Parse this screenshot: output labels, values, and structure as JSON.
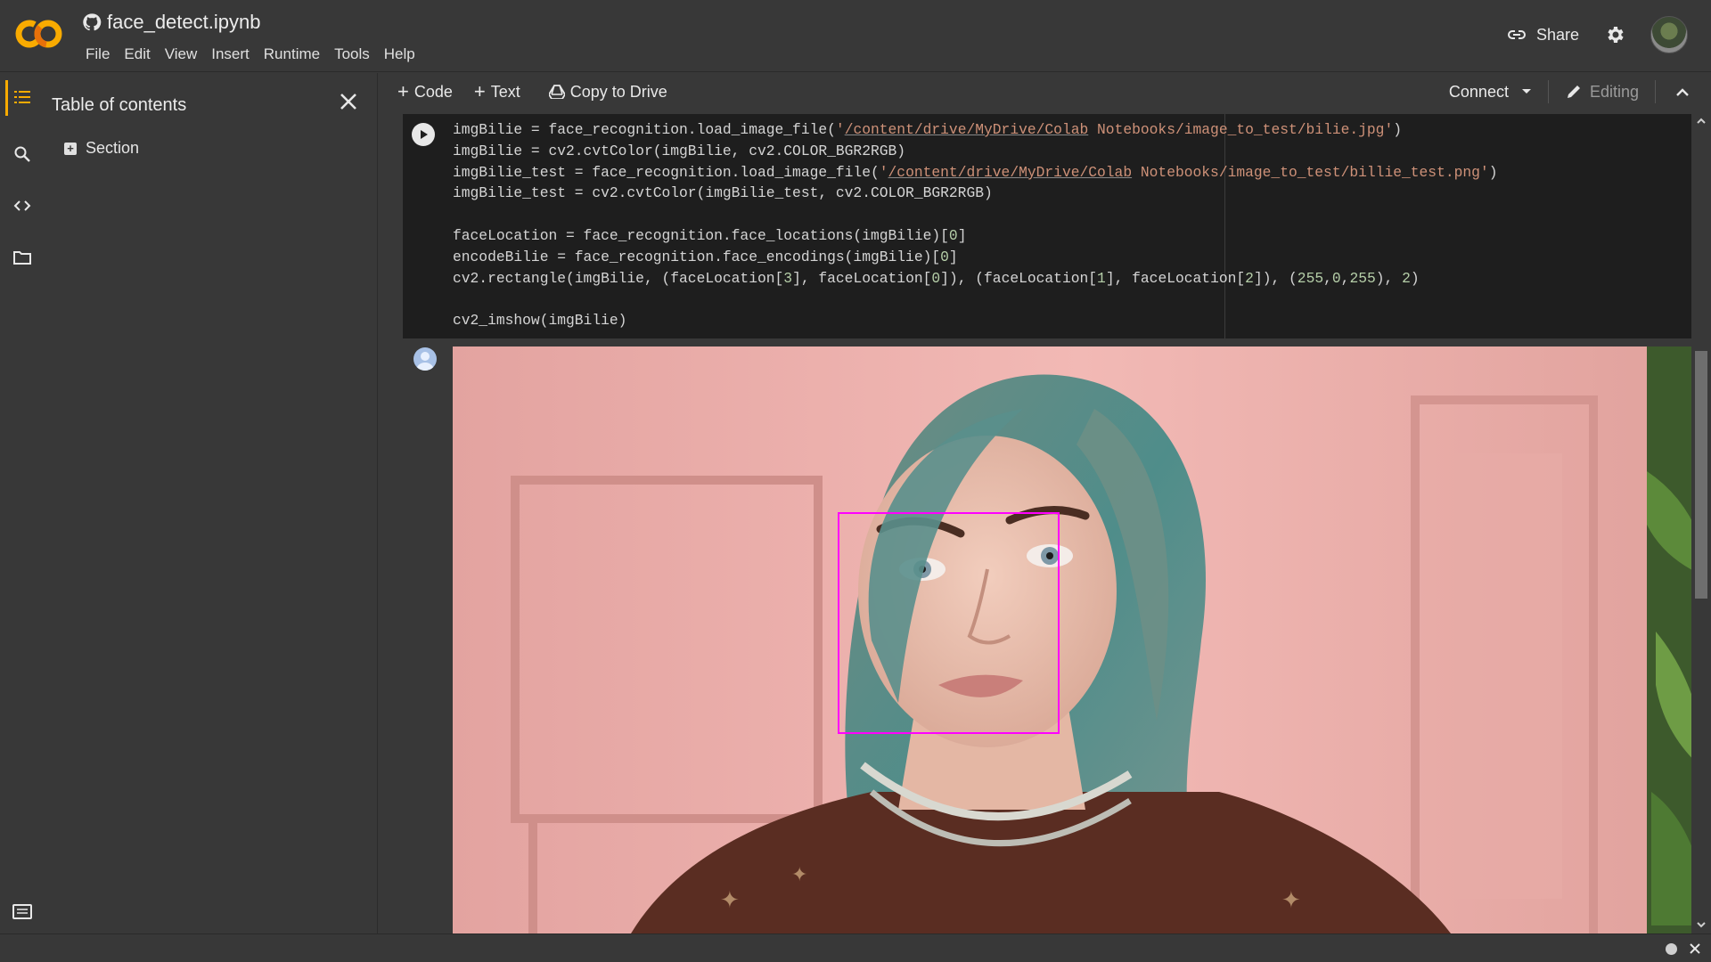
{
  "app": {
    "notebook_title": "face_detect.ipynb",
    "logo_text": "CO",
    "brand_colors": {
      "orange": "#f9ab00",
      "amber": "#e8710a"
    }
  },
  "menu": [
    "File",
    "Edit",
    "View",
    "Insert",
    "Runtime",
    "Tools",
    "Help"
  ],
  "header": {
    "share_label": "Share"
  },
  "toc": {
    "title": "Table of contents",
    "items": [
      {
        "label": "Section"
      }
    ]
  },
  "toolbar": {
    "code_label": "Code",
    "text_label": "Text",
    "copy_label": "Copy to Drive",
    "connect_label": "Connect",
    "editing_label": "Editing"
  },
  "code": {
    "lines": [
      {
        "parts": [
          {
            "t": "imgBilie = face_recognition.load_image_file("
          },
          {
            "t": "'",
            "c": "str"
          },
          {
            "t": "/content/drive/MyDrive/Colab",
            "c": "str link"
          },
          {
            "t": " Notebooks/image_to_test/bilie.jpg'",
            "c": "str"
          },
          {
            "t": ")"
          }
        ]
      },
      {
        "parts": [
          {
            "t": "imgBilie = cv2.cvtColor(imgBilie, cv2.COLOR_BGR2RGB)"
          }
        ]
      },
      {
        "parts": [
          {
            "t": "imgBilie_test = face_recognition.load_image_file("
          },
          {
            "t": "'",
            "c": "str"
          },
          {
            "t": "/content/drive/MyDrive/Colab",
            "c": "str link"
          },
          {
            "t": " Notebooks/image_to_test/billie_test.png'",
            "c": "str"
          },
          {
            "t": ")"
          }
        ]
      },
      {
        "parts": [
          {
            "t": "imgBilie_test = cv2.cvtColor(imgBilie_test, cv2.COLOR_BGR2RGB)"
          }
        ]
      },
      {
        "parts": [
          {
            "t": ""
          }
        ]
      },
      {
        "parts": [
          {
            "t": "faceLocation = face_recognition.face_locations(imgBilie)["
          },
          {
            "t": "0",
            "c": "num"
          },
          {
            "t": "]"
          }
        ]
      },
      {
        "parts": [
          {
            "t": "encodeBilie = face_recognition.face_encodings(imgBilie)["
          },
          {
            "t": "0",
            "c": "num"
          },
          {
            "t": "]"
          }
        ]
      },
      {
        "parts": [
          {
            "t": "cv2.rectangle(imgBilie, (faceLocation["
          },
          {
            "t": "3",
            "c": "num"
          },
          {
            "t": "], faceLocation["
          },
          {
            "t": "0",
            "c": "num"
          },
          {
            "t": "]), (faceLocation["
          },
          {
            "t": "1",
            "c": "num"
          },
          {
            "t": "], faceLocation["
          },
          {
            "t": "2",
            "c": "num"
          },
          {
            "t": "]), ("
          },
          {
            "t": "255",
            "c": "num"
          },
          {
            "t": ","
          },
          {
            "t": "0",
            "c": "num"
          },
          {
            "t": ","
          },
          {
            "t": "255",
            "c": "num"
          },
          {
            "t": "), "
          },
          {
            "t": "2",
            "c": "num"
          },
          {
            "t": ")"
          }
        ]
      },
      {
        "parts": [
          {
            "t": ""
          }
        ]
      },
      {
        "parts": [
          {
            "t": "cv2_imshow(imgBilie)"
          }
        ]
      }
    ]
  },
  "output": {
    "image_description_icon": "portrait-photo-icon",
    "face_box_color": "#ff00ff"
  },
  "icons": {
    "toc": "toc-icon",
    "search": "search-icon",
    "code_snippets": "code-icon",
    "files": "folder-icon",
    "terminal": "terminal-icon",
    "settings": "gear-icon",
    "share": "link-icon",
    "github": "github-icon",
    "drive": "drive-icon"
  }
}
